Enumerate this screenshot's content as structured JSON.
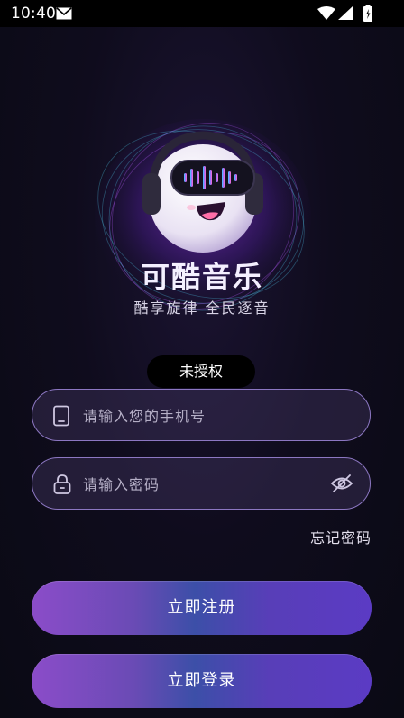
{
  "status_bar": {
    "time": "10:40",
    "icons": [
      "mail-icon",
      "wifi-icon",
      "signal-icon",
      "battery-icon"
    ]
  },
  "brand": {
    "name": "可酷音乐",
    "slogan": "酷享旋律 全民逐音",
    "accent": "#8c77c2"
  },
  "badge": {
    "label": "未授权"
  },
  "form": {
    "phone": {
      "placeholder": "请输入您的手机号",
      "value": "",
      "icon": "phone-icon"
    },
    "password": {
      "placeholder": "请输入密码",
      "value": "",
      "icon": "lock-icon",
      "toggle_icon": "eye-off-icon"
    },
    "forgot_label": "忘记密码"
  },
  "buttons": {
    "register_label": "立即注册",
    "login_label": "立即登录"
  }
}
